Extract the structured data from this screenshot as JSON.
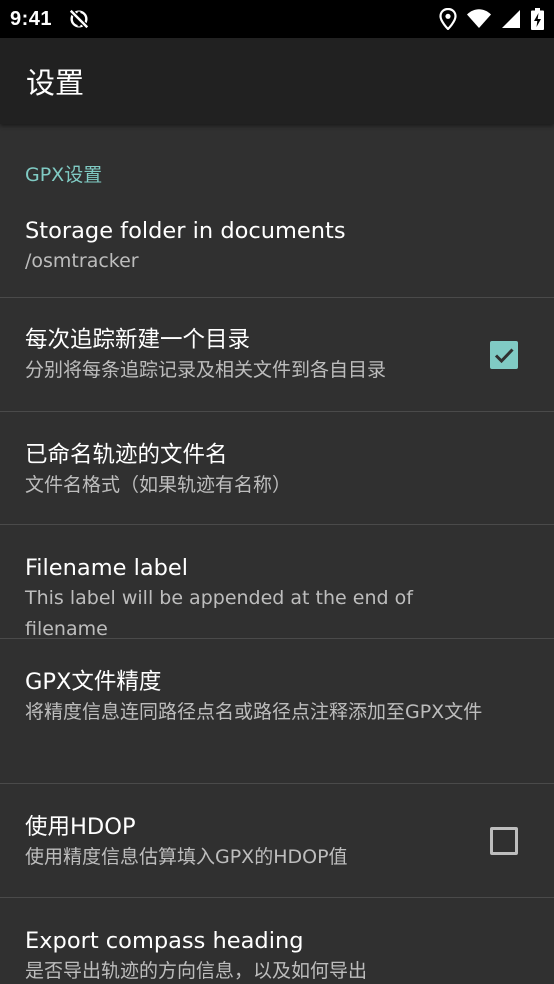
{
  "status_bar": {
    "time": "9:41",
    "icons": [
      "no-sync-icon",
      "location-icon",
      "wifi-icon",
      "signal-icon",
      "battery-icon"
    ]
  },
  "toolbar": {
    "title": "设置"
  },
  "category": {
    "title": "GPX设置"
  },
  "prefs": [
    {
      "title": "Storage folder in documents",
      "summary": "/osmtracker"
    },
    {
      "title": "每次追踪新建一个目录",
      "summary": "分别将每条追踪记录及相关文件到各自目录",
      "checked": true
    },
    {
      "title": "已命名轨迹的文件名",
      "summary": "文件名格式（如果轨迹有名称）"
    },
    {
      "title": "Filename label",
      "summary": "This label will be appended at the end of filename"
    },
    {
      "title": "GPX文件精度",
      "summary": "将精度信息连同路径点名或路径点注释添加至GPX文件"
    },
    {
      "title": "使用HDOP",
      "summary": "使用精度信息估算填入GPX的HDOP值",
      "checked": false
    },
    {
      "title": "Export compass heading",
      "summary": "是否导出轨迹的方向信息，以及如何导出"
    }
  ],
  "colors": {
    "background": "#303030",
    "toolbar": "#212121",
    "status_bar": "#000000",
    "accent": "#80cbc4",
    "divider": "#4a4a4a",
    "summary_text": "#bdbdbd"
  }
}
